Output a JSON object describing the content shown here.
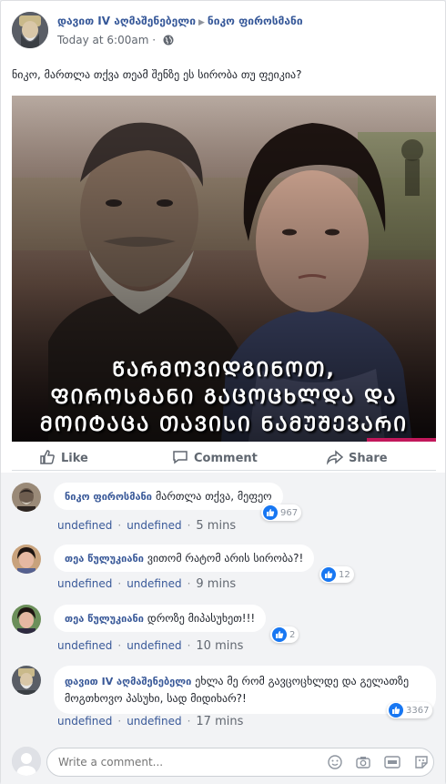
{
  "post": {
    "author": "დავით IV აღმაშენებელი",
    "target": "ნიკო ფიროსმანი",
    "timestamp": "Today at 6:00am",
    "text": "ნიკო, მართლა თქვა თეამ შენზე ეს სირობა თუ ფეიკია?",
    "image_caption": [
      "ᲬᲐᲠᲛᲝᲕᲘᲓᲒᲘᲜᲝᲗ,",
      "ᲤᲘᲠᲝᲡᲛᲐᲜᲘ ᲒᲐᲪᲝᲪᲮᲚᲓᲐ ᲓᲐ",
      "ᲛᲝᲘᲢᲐᲪᲐ ᲗᲐᲕᲘᲡᲘ ᲜᲐᲛᲣᲨᲔᲕᲐᲠᲘ"
    ]
  },
  "actions": {
    "like": "Like",
    "comment": "Comment",
    "share": "Share"
  },
  "comments": [
    {
      "name": "ნიკო ფიროსმანი",
      "text": "მართლა თქვა, მეფეო",
      "likes": "967",
      "link1": "undefined",
      "link2": "undefined",
      "time": "5 mins"
    },
    {
      "name": "თეა წულუკიანი",
      "text": "ვითომ რატომ არის სირობა?!",
      "likes": "12",
      "link1": "undefined",
      "link2": "undefined",
      "time": "9 mins"
    },
    {
      "name": "თეა წულუკიანი",
      "text": "დროზე მიპასუხეთ!!!",
      "likes": "2",
      "link1": "undefined",
      "link2": "undefined",
      "time": "10 mins"
    },
    {
      "name": "დავით IV აღმაშენებელი",
      "text": "ეხლა მე რომ გავცოცხლდე და გელათზე მოგთხოვო პასუხი, სად მიდიხარ?!",
      "likes": "3367",
      "link1": "undefined",
      "link2": "undefined",
      "time": "17 mins"
    }
  ],
  "composer": {
    "placeholder": "Write a comment..."
  }
}
